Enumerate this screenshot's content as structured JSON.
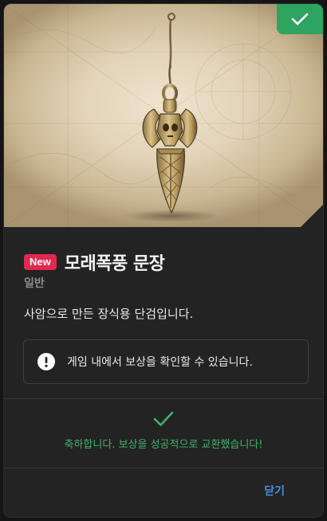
{
  "item": {
    "badge": "New",
    "name": "모래폭풍 문장",
    "grade": "일반",
    "description": "사암으로 만든 장식용 단검입니다."
  },
  "notice": {
    "text": "게임 내에서 보상을 확인할 수 있습니다.",
    "icon": "exclamation-circle-icon"
  },
  "success": {
    "text": "축하합니다. 보상을 성공적으로 교환했습니다!",
    "icon": "check-icon"
  },
  "actions": {
    "close_label": "닫기"
  },
  "colors": {
    "accent_green": "#2fa360",
    "new_badge": "#e0294f",
    "link_blue": "#4a90e2",
    "card_bg": "#232323"
  }
}
